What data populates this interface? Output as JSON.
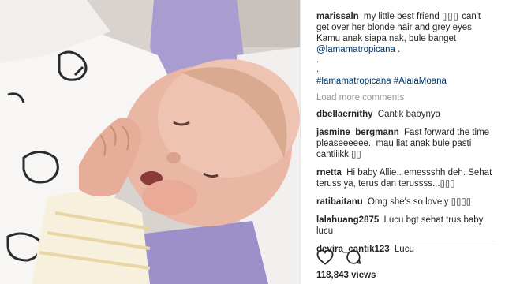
{
  "post": {
    "author": "marissaln",
    "caption_text": "my little best friend",
    "caption_symbols": "▯▯▯",
    "caption_text_2": "can't get over her blonde hair and grey eyes. Kamu anak siapa nak, bule banget",
    "mention": "@lamamatropicana",
    "mention_suffix": ".",
    "dots": [
      ".",
      "."
    ],
    "hashtags": "#lamamatropicana #AlaiaMoana"
  },
  "load_more_label": "Load more comments",
  "comments": [
    {
      "user": "dbellaernithy",
      "text": "Cantik babynya"
    },
    {
      "user": "jasmine_bergmann",
      "text": "Fast forward the time pleaseeeeee.. mau liat anak bule pasti cantiiikk ▯▯"
    },
    {
      "user": "rnetta",
      "text": "Hi baby Allie.. emessshh deh. Sehat teruss ya, terus dan terussss...▯▯▯"
    },
    {
      "user": "ratibaitanu",
      "text": "Omg she's so lovely ▯▯▯▯"
    },
    {
      "user": "lalahuang2875",
      "text": "Lucu bgt sehat trus baby lucu"
    },
    {
      "user": "devira_cantik123",
      "text": "Lucu"
    }
  ],
  "actions": {
    "like_icon": "heart-icon",
    "comment_icon": "comment-icon"
  },
  "views_label": "118,843 views",
  "colors": {
    "link": "#003569",
    "muted": "#999999",
    "text": "#262626"
  }
}
